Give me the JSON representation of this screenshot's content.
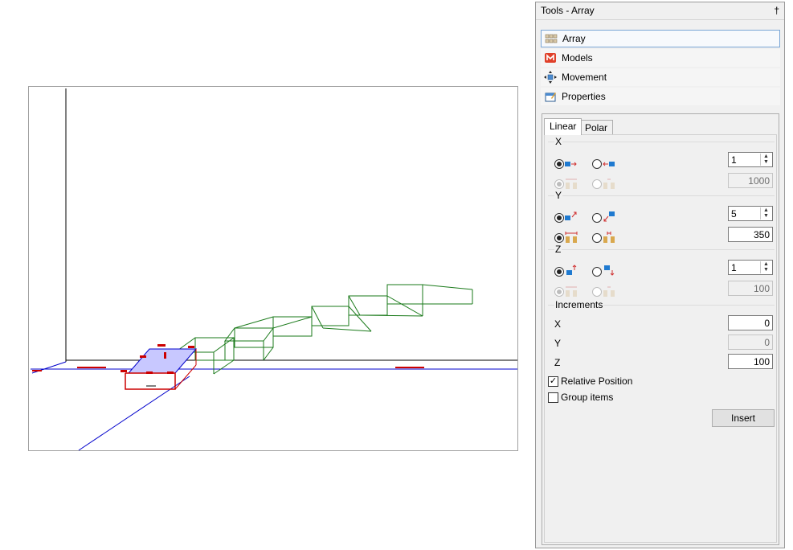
{
  "panel": {
    "title": "Tools - Array",
    "pin_glyph": "†"
  },
  "nav": {
    "items": [
      {
        "label": "Array",
        "icon": "array-icon"
      },
      {
        "label": "Models",
        "icon": "models-icon"
      },
      {
        "label": "Movement",
        "icon": "movement-icon"
      },
      {
        "label": "Properties",
        "icon": "properties-icon"
      }
    ]
  },
  "tabs": [
    "Linear",
    "Polar"
  ],
  "x": {
    "label": "X",
    "count": "1",
    "distance": "1000"
  },
  "y": {
    "label": "Y",
    "count": "5",
    "distance": "350"
  },
  "z": {
    "label": "Z",
    "count": "1",
    "distance": "100"
  },
  "increments": {
    "label": "Increments",
    "x_label": "X",
    "x_value": "0",
    "y_label": "Y",
    "y_value": "0",
    "z_label": "Z",
    "z_value": "100"
  },
  "options": {
    "relative_position": "Relative Position",
    "group_items": "Group items",
    "check_glyph": "✓"
  },
  "insert_label": "Insert",
  "spin_up": "▲",
  "spin_down": "▼",
  "colors": {
    "accent": "#7aa6d6",
    "model_green": "#1a7a1a",
    "axis_blue": "#0000cc",
    "selected_fill": "#c8c8ff",
    "selection_red": "#cc0000"
  }
}
